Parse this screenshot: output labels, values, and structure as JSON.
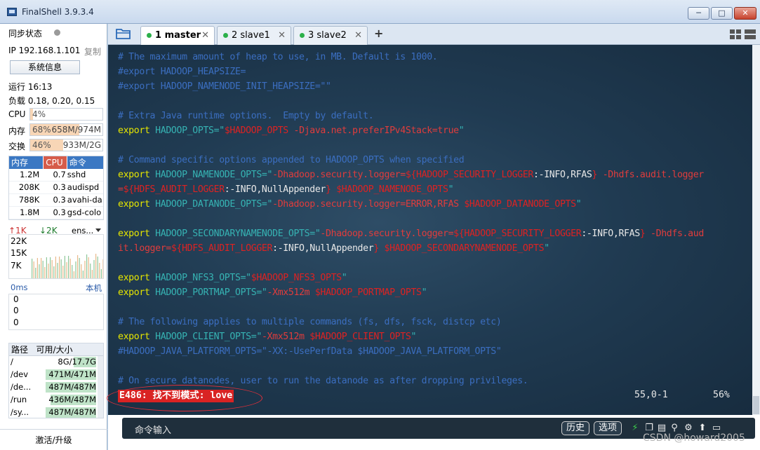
{
  "window": {
    "title": "FinalShell 3.9.3.4",
    "min": "─",
    "max": "□",
    "close": "✕"
  },
  "sidebar": {
    "sync_label": "同步状态",
    "ip": "IP 192.168.1.101",
    "copy": "复制",
    "sysinfo_button": "系统信息",
    "uptime": "运行 16:13",
    "load": "负载 0.18, 0.20, 0.15",
    "cpu": {
      "label": "CPU",
      "value": "4%",
      "level": 0.04
    },
    "mem": {
      "label": "内存",
      "percent": "68%",
      "value": "658M/974M",
      "level": 0.68
    },
    "swap": {
      "label": "交换",
      "percent": "46%",
      "value": "933M/2G",
      "level": 0.46
    },
    "proc_headers": [
      "内存",
      "CPU",
      "命令"
    ],
    "processes": [
      {
        "mem": "1.2M",
        "cpu": "0.7",
        "cmd": "sshd"
      },
      {
        "mem": "208K",
        "cpu": "0.3",
        "cmd": "audispd"
      },
      {
        "mem": "788K",
        "cpu": "0.3",
        "cmd": "avahi-da"
      },
      {
        "mem": "1.8M",
        "cpu": "0.3",
        "cmd": "gsd-colo"
      }
    ],
    "net": {
      "up": "↑1K",
      "down": "↓2K",
      "iface": "ens...",
      "ticks": [
        "22K",
        "15K",
        "7K"
      ]
    },
    "latency": {
      "label": "0ms",
      "host": "本机",
      "values": [
        "0",
        "0",
        "0"
      ]
    },
    "disk_headers": [
      "路径",
      "可用/大小"
    ],
    "disks": [
      {
        "path": "/",
        "size": "8G/17.7G",
        "level": 0.45
      },
      {
        "path": "/dev",
        "size": "471M/471M",
        "level": 1.0
      },
      {
        "path": "/de...",
        "size": "487M/487M",
        "level": 1.0
      },
      {
        "path": "/run",
        "size": "436M/487M",
        "level": 0.9
      },
      {
        "path": "/sy...",
        "size": "487M/487M",
        "level": 1.0
      }
    ],
    "upgrade": "激活/升级"
  },
  "tabs": [
    {
      "label": "1 master",
      "close": "✕"
    },
    {
      "label": "2 slave1",
      "close": "✕"
    },
    {
      "label": "3 slave2",
      "close": "✕"
    }
  ],
  "tabbar": {
    "add": "+"
  },
  "terminal": {
    "lines": [
      [
        {
          "c": "cm",
          "t": "# The maximum amount of heap to use, in MB. Default is 1000."
        }
      ],
      [
        {
          "c": "cm",
          "t": "#export HADOOP_HEAPSIZE="
        }
      ],
      [
        {
          "c": "cm",
          "t": "#export HADOOP_NAMENODE_INIT_HEAPSIZE=\"\""
        }
      ],
      [],
      [
        {
          "c": "cm",
          "t": "# Extra Java runtime options.  Empty by default."
        }
      ],
      [
        {
          "c": "kw",
          "t": "export"
        },
        {
          "c": "vr",
          "t": " HADOOP_OPTS=\""
        },
        {
          "c": "sv",
          "t": "$HADOOP_OPTS"
        },
        {
          "c": "st",
          "t": " -Djava.net.preferIPv4Stack=true"
        },
        {
          "c": "vr",
          "t": "\""
        }
      ],
      [],
      [
        {
          "c": "cm",
          "t": "# Command specific options appended to HADOOP_OPTS when specified"
        }
      ],
      [
        {
          "c": "kw",
          "t": "export"
        },
        {
          "c": "vr",
          "t": " HADOOP_NAMENODE_OPTS=\""
        },
        {
          "c": "st",
          "t": "-Dhadoop.security.logger="
        },
        {
          "c": "sv",
          "t": "${HADOOP_SECURITY_LOGGER"
        },
        {
          "c": "pl",
          "t": ":-INFO,RFAS"
        },
        {
          "c": "sv",
          "t": "}"
        },
        {
          "c": "st",
          "t": " -Dhdfs.audit.logger"
        }
      ],
      [
        {
          "c": "st",
          "t": "="
        },
        {
          "c": "sv",
          "t": "${HDFS_AUDIT_LOGGER"
        },
        {
          "c": "pl",
          "t": ":-INFO,NullAppender"
        },
        {
          "c": "sv",
          "t": "}"
        },
        {
          "c": "st",
          "t": " "
        },
        {
          "c": "sv",
          "t": "$HADOOP_NAMENODE_OPTS"
        },
        {
          "c": "vr",
          "t": "\""
        }
      ],
      [
        {
          "c": "kw",
          "t": "export"
        },
        {
          "c": "vr",
          "t": " HADOOP_DATANODE_OPTS=\""
        },
        {
          "c": "st",
          "t": "-Dhadoop.security.logger=ERROR,RFAS "
        },
        {
          "c": "sv",
          "t": "$HADOOP_DATANODE_OPTS"
        },
        {
          "c": "vr",
          "t": "\""
        }
      ],
      [],
      [
        {
          "c": "kw",
          "t": "export"
        },
        {
          "c": "vr",
          "t": " HADOOP_SECONDARYNAMENODE_OPTS=\""
        },
        {
          "c": "st",
          "t": "-Dhadoop.security.logger="
        },
        {
          "c": "sv",
          "t": "${HADOOP_SECURITY_LOGGER"
        },
        {
          "c": "pl",
          "t": ":-INFO,RFAS"
        },
        {
          "c": "sv",
          "t": "}"
        },
        {
          "c": "st",
          "t": " -Dhdfs.aud"
        }
      ],
      [
        {
          "c": "st",
          "t": "it.logger="
        },
        {
          "c": "sv",
          "t": "${HDFS_AUDIT_LOGGER"
        },
        {
          "c": "pl",
          "t": ":-INFO,NullAppender"
        },
        {
          "c": "sv",
          "t": "}"
        },
        {
          "c": "st",
          "t": " "
        },
        {
          "c": "sv",
          "t": "$HADOOP_SECONDARYNAMENODE_OPTS"
        },
        {
          "c": "vr",
          "t": "\""
        }
      ],
      [],
      [
        {
          "c": "kw",
          "t": "export"
        },
        {
          "c": "vr",
          "t": " HADOOP_NFS3_OPTS=\""
        },
        {
          "c": "sv",
          "t": "$HADOOP_NFS3_OPTS"
        },
        {
          "c": "vr",
          "t": "\""
        }
      ],
      [
        {
          "c": "kw",
          "t": "export"
        },
        {
          "c": "vr",
          "t": " HADOOP_PORTMAP_OPTS=\""
        },
        {
          "c": "st",
          "t": "-Xmx512m "
        },
        {
          "c": "sv",
          "t": "$HADOOP_PORTMAP_OPTS"
        },
        {
          "c": "vr",
          "t": "\""
        }
      ],
      [],
      [
        {
          "c": "cm",
          "t": "# The following applies to multiple commands (fs, dfs, fsck, distcp etc)"
        }
      ],
      [
        {
          "c": "kw",
          "t": "export"
        },
        {
          "c": "vr",
          "t": " HADOOP_CLIENT_OPTS=\""
        },
        {
          "c": "st",
          "t": "-Xmx512m "
        },
        {
          "c": "sv",
          "t": "$HADOOP_CLIENT_OPTS"
        },
        {
          "c": "vr",
          "t": "\""
        }
      ],
      [
        {
          "c": "cm",
          "t": "#HADOOP_JAVA_PLATFORM_OPTS=\"-XX:-UsePerfData $HADOOP_JAVA_PLATFORM_OPTS\""
        }
      ],
      [],
      [
        {
          "c": "cm",
          "t": "# On secure datanodes, user to run the datanode as after dropping privileges."
        }
      ]
    ],
    "error": "E486: 找不到模式: love",
    "cursor_pos": "55,0-1",
    "percent": "56%"
  },
  "cmdbar": {
    "label": "命令输入",
    "history": "历史",
    "options": "选项"
  },
  "watermark": "CSDN @howard2005"
}
